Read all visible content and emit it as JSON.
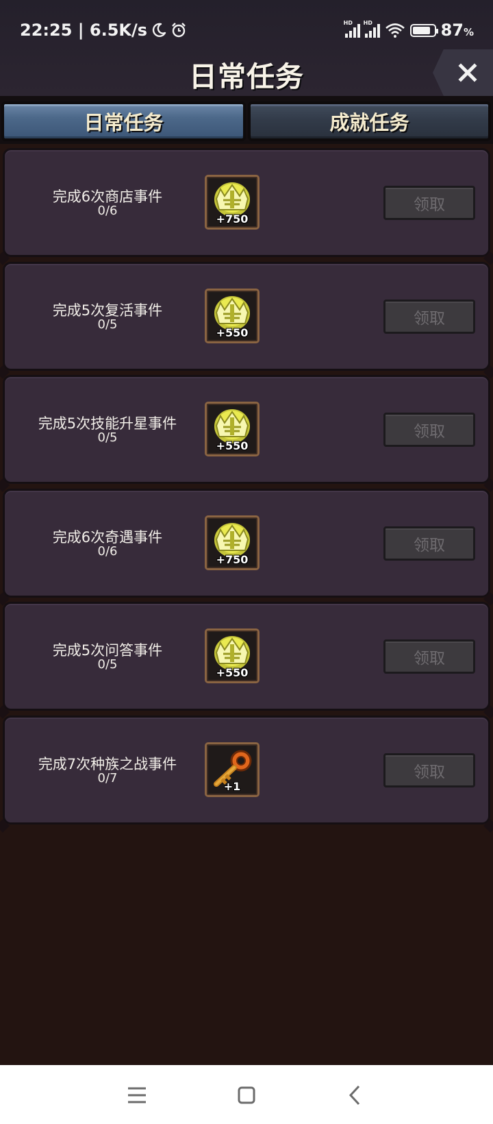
{
  "status_bar": {
    "time_speed": "22:25 | 6.5K/s",
    "hd1": "HD",
    "hd2": "HD",
    "battery_percent": "87",
    "battery_sign": "%",
    "battery_level": 0.87,
    "icons": [
      "moon-icon",
      "alarm-icon",
      "signal-icon",
      "signal-icon",
      "wifi-icon",
      "battery-icon"
    ]
  },
  "header": {
    "title": "日常任务",
    "close_icon": "close-icon"
  },
  "tabs": [
    {
      "label": "日常任务",
      "active": true
    },
    {
      "label": "成就任务",
      "active": false
    }
  ],
  "tasks": [
    {
      "title": "完成6次商店事件",
      "progress": "0/6",
      "reward_icon": "crown-coin-icon",
      "reward_amount": "+750",
      "button": "领取"
    },
    {
      "title": "完成5次复活事件",
      "progress": "0/5",
      "reward_icon": "crown-coin-icon",
      "reward_amount": "+550",
      "button": "领取"
    },
    {
      "title": "完成5次技能升星事件",
      "progress": "0/5",
      "reward_icon": "crown-coin-icon",
      "reward_amount": "+550",
      "button": "领取"
    },
    {
      "title": "完成6次奇遇事件",
      "progress": "0/6",
      "reward_icon": "crown-coin-icon",
      "reward_amount": "+750",
      "button": "领取"
    },
    {
      "title": "完成5次问答事件",
      "progress": "0/5",
      "reward_icon": "crown-coin-icon",
      "reward_amount": "+550",
      "button": "领取"
    },
    {
      "title": "完成7次种族之战事件",
      "progress": "0/7",
      "reward_icon": "key-icon",
      "reward_amount": "+1",
      "button": "领取"
    }
  ],
  "nav_bar": {
    "icons": [
      "menu-icon",
      "home-icon",
      "back-icon"
    ]
  },
  "colors": {
    "background": "#231411",
    "card": "#372b3a",
    "active_tab": "#4c6889",
    "inactive_tab": "#323b49",
    "coin_yellow": "#e6e64a",
    "key_orange": "#e0661c"
  }
}
